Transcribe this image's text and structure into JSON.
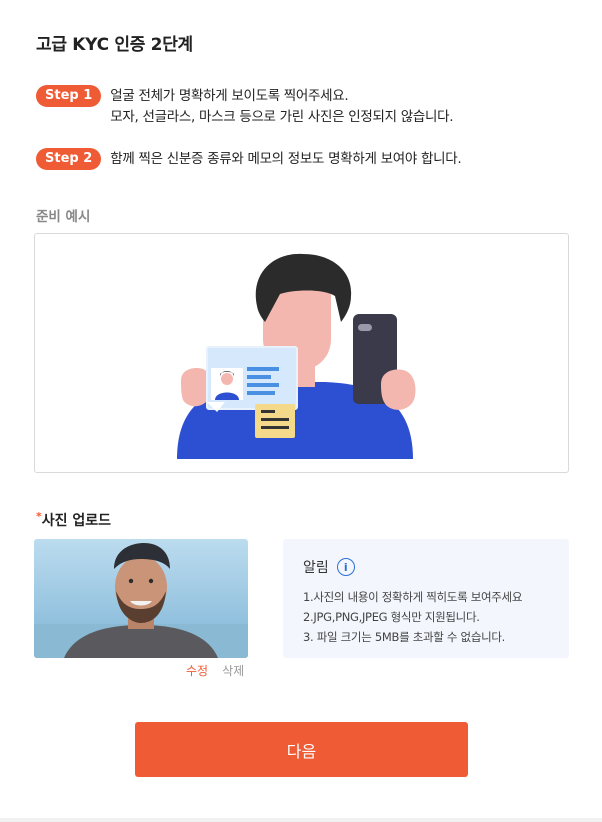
{
  "header": {
    "title": "고급 KYC 인증 2단계"
  },
  "steps": [
    {
      "badge": "Step 1",
      "lines": [
        "얼굴 전체가 명확하게 보이도록 찍어주세요.",
        "모자, 선글라스, 마스크 등으로 가린 사진은 인정되지 않습니다."
      ]
    },
    {
      "badge": "Step 2",
      "lines": [
        "함께 찍은 신분증 종류와 메모의 정보도 명확하게 보여야 합니다."
      ]
    }
  ],
  "example": {
    "label": "준비 예시"
  },
  "upload": {
    "required_mark": "*",
    "label": "사진 업로드",
    "edit_label": "수정",
    "delete_label": "삭제"
  },
  "notice": {
    "title": "알림",
    "icon": "info-icon",
    "items": [
      "1.사진의 내용이 정확하게 찍히도록 보여주세요",
      "2.JPG,PNG,JPEG 형식만 지원됩니다.",
      "3. 파일 크기는 5MB를 초과할 수 없습니다."
    ]
  },
  "actions": {
    "next_label": "다음"
  },
  "colors": {
    "accent": "#ef5b35",
    "info": "#2d6fd8",
    "notice_bg": "#f3f7fd"
  }
}
